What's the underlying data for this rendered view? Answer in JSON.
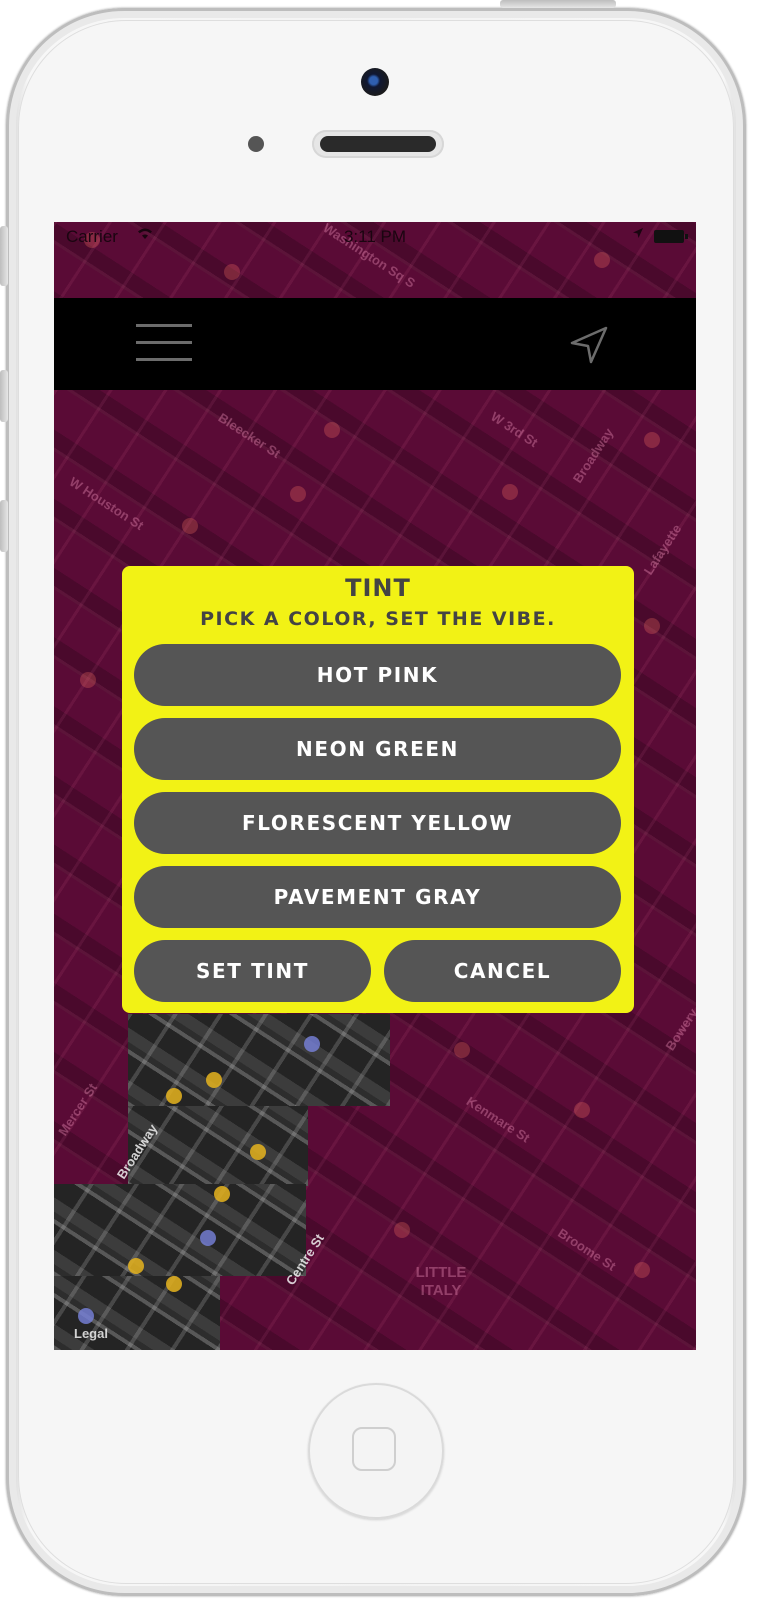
{
  "status_bar": {
    "carrier": "Carrier",
    "time": "3:11 PM"
  },
  "navbar": {
    "menu_icon": "hamburger-menu-icon",
    "locate_icon": "location-arrow-icon"
  },
  "map": {
    "labels": [
      "Washington Sq S",
      "Bleecker St",
      "W 3rd St",
      "Broadway",
      "W Houston St",
      "Lafayette",
      "Mercer St",
      "Broadway",
      "Kenmare St",
      "Centre St",
      "Broome St",
      "LITTLE ITALY",
      "Bowery",
      "Legal"
    ]
  },
  "dialog": {
    "title": "TINT",
    "subtitle": "PICK A COLOR, SET THE VIBE.",
    "options": [
      "HOT PINK",
      "NEON GREEN",
      "FLORESCENT YELLOW",
      "PAVEMENT GRAY"
    ],
    "set_label": "SET TINT",
    "cancel_label": "CANCEL"
  },
  "colors": {
    "tint_overlay": "#5a0b36",
    "dialog_bg": "#f2f215",
    "button_bg": "#555555",
    "button_text": "#ffffff",
    "navbar_bg": "#000000"
  }
}
